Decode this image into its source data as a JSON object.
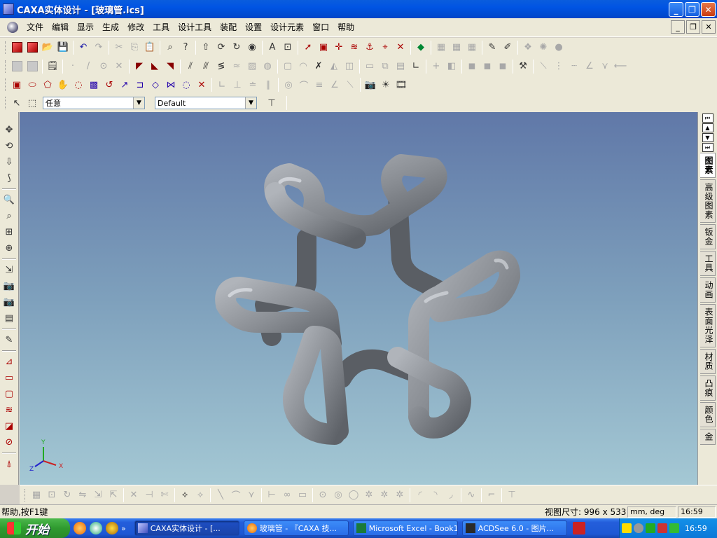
{
  "window": {
    "title": "CAXA实体设计 - [玻璃管.ics]",
    "controls": {
      "minimize": "_",
      "restore": "❐",
      "close": "✕"
    }
  },
  "menu": {
    "items": [
      "文件",
      "编辑",
      "显示",
      "生成",
      "修改",
      "工具",
      "设计工具",
      "装配",
      "设置",
      "设计元素",
      "窗口",
      "帮助"
    ]
  },
  "toolbar": {
    "selection_filter": "任意",
    "style_select": "Default"
  },
  "right_panel": {
    "tabs": [
      "图素",
      "高级图素",
      "钣金",
      "工具",
      "动画",
      "表面光泽",
      "材质",
      "凸痕",
      "颜色",
      "金"
    ]
  },
  "axis_triad": {
    "x": "X",
    "y": "Y",
    "z": "Z"
  },
  "status": {
    "help": "帮助,按F1键",
    "view_size_label": "视图尺寸:",
    "view_size": "996 x 533",
    "units": "mm, deg",
    "time": "16:59"
  },
  "taskbar": {
    "start": "开始",
    "tasks": [
      {
        "label": "CAXA实体设计 - [..."
      },
      {
        "label": "玻璃管 - 『CAXA 技..."
      },
      {
        "label": "Microsoft Excel - Book1"
      },
      {
        "label": "ACDSee 6.0 - 图片..."
      }
    ],
    "clock": "16:59"
  },
  "colors": {
    "titlebar": "#0054e3",
    "viewport_top": "#6078a8",
    "viewport_bottom": "#a4c8d4",
    "tube": "#8c9096"
  }
}
